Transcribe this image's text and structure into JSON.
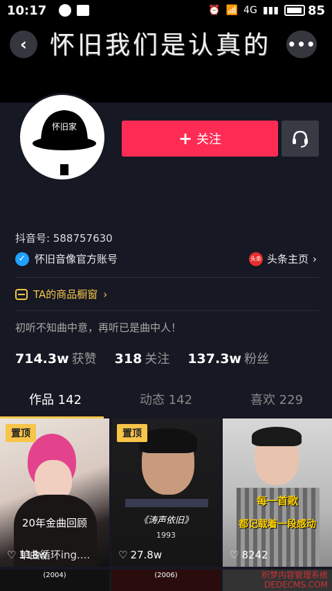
{
  "status_bar": {
    "time": "10:17",
    "network": "4G",
    "battery": "85"
  },
  "header": {
    "title": "怀旧我们是认真的"
  },
  "profile": {
    "avatar_text": "怀旧家",
    "follow_label": "关注",
    "uid_label": "抖音号: 588757630",
    "verified_label": "怀旧音像官方账号",
    "toutiao_icon_text": "头条",
    "toutiao_label": "头条主页",
    "shop_label": "TA的商品橱窗",
    "bio": "初听不知曲中意，再听已是曲中人！",
    "stats": [
      {
        "num": "714.3w",
        "label": "获赞"
      },
      {
        "num": "318",
        "label": "关注"
      },
      {
        "num": "137.3w",
        "label": "粉丝"
      }
    ]
  },
  "tabs": [
    {
      "label": "作品 142"
    },
    {
      "label": "动态 142"
    },
    {
      "label": "喜欢 229"
    }
  ],
  "videos": [
    {
      "pinned": "置顶",
      "caption": "20年金曲回顾",
      "subcaption": "单曲循环ing....",
      "likes": "118w"
    },
    {
      "pinned": "置顶",
      "caption": "《涛声依旧》",
      "subcaption": "1993",
      "likes": "27.8w"
    },
    {
      "caption": "每一首歌",
      "subcaption": "都记载着一段感动",
      "likes": "8242"
    }
  ],
  "row2": [
    "(2004)",
    "(2006)"
  ],
  "watermark": {
    "line1": "织梦内容管理系统",
    "line2": "DEDECMS.COM"
  },
  "colors": {
    "accent": "#fe2c55",
    "gold": "#f7c54a",
    "bg": "#161823"
  }
}
